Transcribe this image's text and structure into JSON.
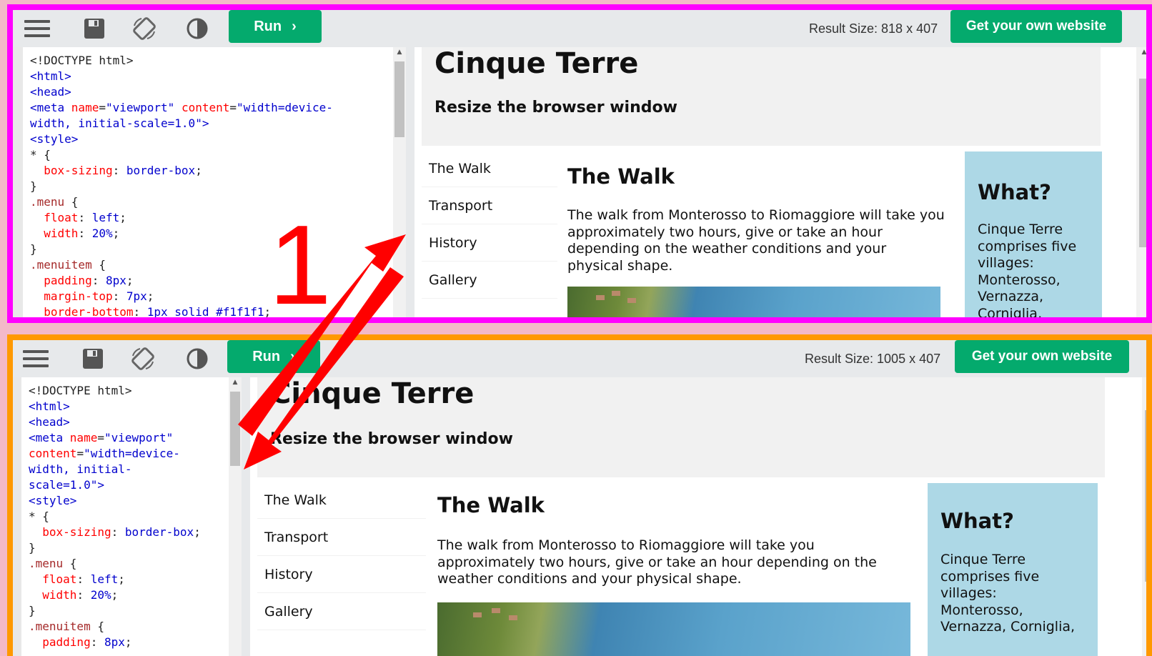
{
  "top": {
    "run_label": "Run",
    "result_size": "Result Size: 818 x 407",
    "get_site": "Get your own website",
    "code": [
      [
        [
          "x",
          "<!DOCTYPE html>"
        ]
      ],
      [
        [
          "t",
          "<html>"
        ]
      ],
      [
        [
          "t",
          "<head>"
        ]
      ],
      [
        [
          "t",
          "<meta "
        ],
        [
          "a",
          "name"
        ],
        [
          "x",
          "="
        ],
        [
          "v",
          "\"viewport\" "
        ],
        [
          "a",
          "content"
        ],
        [
          "x",
          "="
        ],
        [
          "v",
          "\"width=device-"
        ]
      ],
      [
        [
          "v",
          "width, initial-scale=1.0\">"
        ]
      ],
      [
        [
          "t",
          "<style>"
        ]
      ],
      [
        [
          "x",
          "* {"
        ]
      ],
      [
        [
          "x",
          "  "
        ],
        [
          "p",
          "box-sizing"
        ],
        [
          "x",
          ": "
        ],
        [
          "v",
          "border-box"
        ],
        [
          "x",
          ";"
        ]
      ],
      [
        [
          "x",
          "}"
        ]
      ],
      [
        [
          "s",
          ".menu"
        ],
        [
          "x",
          " {"
        ]
      ],
      [
        [
          "x",
          "  "
        ],
        [
          "p",
          "float"
        ],
        [
          "x",
          ": "
        ],
        [
          "v",
          "left"
        ],
        [
          "x",
          ";"
        ]
      ],
      [
        [
          "x",
          "  "
        ],
        [
          "p",
          "width"
        ],
        [
          "x",
          ": "
        ],
        [
          "v",
          "20%"
        ],
        [
          "x",
          ";"
        ]
      ],
      [
        [
          "x",
          "}"
        ]
      ],
      [
        [
          "s",
          ".menuitem"
        ],
        [
          "x",
          " {"
        ]
      ],
      [
        [
          "x",
          "  "
        ],
        [
          "p",
          "padding"
        ],
        [
          "x",
          ": "
        ],
        [
          "v",
          "8px"
        ],
        [
          "x",
          ";"
        ]
      ],
      [
        [
          "x",
          "  "
        ],
        [
          "p",
          "margin-top"
        ],
        [
          "x",
          ": "
        ],
        [
          "v",
          "7px"
        ],
        [
          "x",
          ";"
        ]
      ],
      [
        [
          "x",
          "  "
        ],
        [
          "p",
          "border-bottom"
        ],
        [
          "x",
          ": "
        ],
        [
          "v",
          "1px solid #f1f1f1"
        ],
        [
          "x",
          ";"
        ]
      ]
    ],
    "aside_text": "Cinque Terre\ncomprises five\nvillages:\nMonterosso,\nVernazza,\nCorniglia,"
  },
  "bottom": {
    "run_label": "Run",
    "result_size": "Result Size: 1005 x 407",
    "get_site": "Get your own website",
    "code": [
      [
        [
          "x",
          "<!DOCTYPE html>"
        ]
      ],
      [
        [
          "t",
          "<html>"
        ]
      ],
      [
        [
          "t",
          "<head>"
        ]
      ],
      [
        [
          "t",
          "<meta "
        ],
        [
          "a",
          "name"
        ],
        [
          "x",
          "="
        ],
        [
          "v",
          "\"viewport\""
        ]
      ],
      [
        [
          "a",
          "content"
        ],
        [
          "x",
          "="
        ],
        [
          "v",
          "\"width=device-"
        ]
      ],
      [
        [
          "v",
          "width, initial-"
        ]
      ],
      [
        [
          "v",
          "scale=1.0\">"
        ]
      ],
      [
        [
          "t",
          "<style>"
        ]
      ],
      [
        [
          "x",
          "* {"
        ]
      ],
      [
        [
          "x",
          "  "
        ],
        [
          "p",
          "box-sizing"
        ],
        [
          "x",
          ": "
        ],
        [
          "v",
          "border-box"
        ],
        [
          "x",
          ";"
        ]
      ],
      [
        [
          "x",
          "}"
        ]
      ],
      [
        [
          "s",
          ".menu"
        ],
        [
          "x",
          " {"
        ]
      ],
      [
        [
          "x",
          "  "
        ],
        [
          "p",
          "float"
        ],
        [
          "x",
          ": "
        ],
        [
          "v",
          "left"
        ],
        [
          "x",
          ";"
        ]
      ],
      [
        [
          "x",
          "  "
        ],
        [
          "p",
          "width"
        ],
        [
          "x",
          ": "
        ],
        [
          "v",
          "20%"
        ],
        [
          "x",
          ";"
        ]
      ],
      [
        [
          "x",
          "}"
        ]
      ],
      [
        [
          "s",
          ".menuitem"
        ],
        [
          "x",
          " {"
        ]
      ],
      [
        [
          "x",
          "  "
        ],
        [
          "p",
          "padding"
        ],
        [
          "x",
          ": "
        ],
        [
          "v",
          "8px"
        ],
        [
          "x",
          ";"
        ]
      ]
    ],
    "aside_text": "Cinque Terre\ncomprises five\nvillages:\nMonterosso,\nVernazza, Corniglia,"
  },
  "site": {
    "title": "Cinque Terre",
    "subtitle": "Resize the browser window",
    "menu": [
      "The Walk",
      "Transport",
      "History",
      "Gallery"
    ],
    "main_heading": "The Walk",
    "main_text": "The walk from Monterosso to Riomaggiore will take you approximately two hours, give or take an hour depending on the weather conditions and your physical shape.",
    "aside_heading": "What?"
  },
  "annotation": {
    "number": "1",
    "color": "#ff0000",
    "top_border_color": "#ff00ff",
    "bottom_border_color": "#ff9900"
  }
}
